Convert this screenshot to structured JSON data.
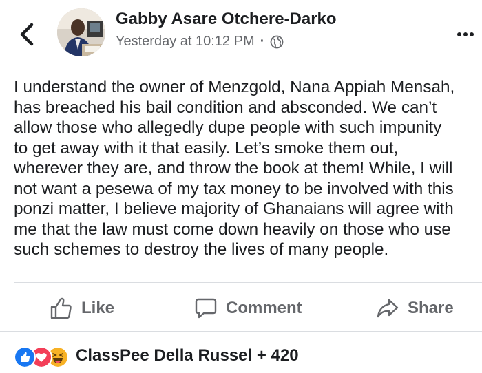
{
  "post": {
    "author": "Gabby Asare Otchere-Darko",
    "timestamp": "Yesterday at 10:12 PM",
    "privacy_icon": "globe-icon",
    "lines": [
      "I understand the owner of Menzgold, Nana Appiah Mensah,",
      "has breached his bail condition and absconded. We can’t",
      "allow those who allegedly dupe people with such impunity",
      "to get away with it that easily. Let’s smoke them out,",
      "wherever they are, and throw the book at them! While, I will",
      "not want a pesewa of my tax money to be involved with this",
      "ponzi matter, I believe majority of Ghanaians will agree with",
      "me that the law must come down heavily on those who use",
      "such schemes to destroy the lives of many people."
    ]
  },
  "actions": {
    "like": "Like",
    "comment": "Comment",
    "share": "Share"
  },
  "reactions": {
    "summary": "ClassPee Della Russel + 420",
    "icons": [
      "like-reaction-icon",
      "love-reaction-icon",
      "haha-reaction-icon"
    ]
  },
  "colors": {
    "like_blue": "#1877f2",
    "love_red": "#f33e58",
    "haha_yellow": "#f7b125",
    "secondary_text": "#65676b"
  }
}
